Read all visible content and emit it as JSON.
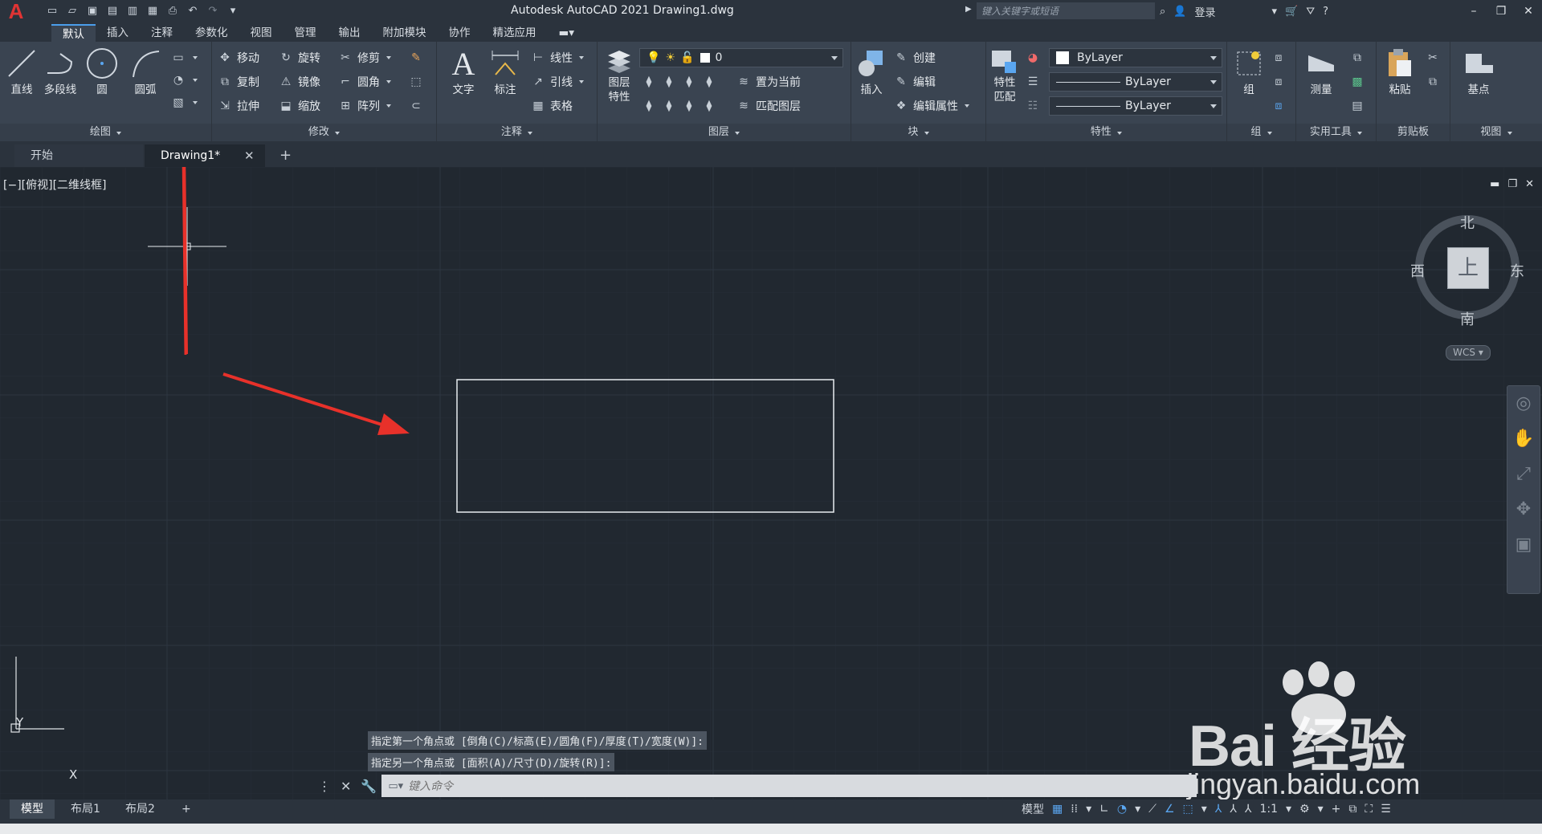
{
  "app": {
    "logo": "A",
    "title": "Autodesk AutoCAD 2021    Drawing1.dwg",
    "search_placeholder": "键入关键字或短语",
    "login": "登录"
  },
  "menu": [
    "默认",
    "插入",
    "注释",
    "参数化",
    "视图",
    "管理",
    "输出",
    "附加模块",
    "协作",
    "精选应用"
  ],
  "ribbon": {
    "draw": {
      "title": "绘图",
      "line": "直线",
      "polyline": "多段线",
      "circle": "圆",
      "arc": "圆弧"
    },
    "modify": {
      "title": "修改",
      "move": "移动",
      "rotate": "旋转",
      "trim": "修剪",
      "copy": "复制",
      "mirror": "镜像",
      "fillet": "圆角",
      "stretch": "拉伸",
      "scale": "缩放",
      "array": "阵列"
    },
    "annotation": {
      "title": "注释",
      "text": "文字",
      "dimension": "标注",
      "linear": "线性",
      "leader": "引线",
      "table": "表格"
    },
    "layers": {
      "title": "图层",
      "layer_properties": "图层\n特性",
      "layer_value": "0",
      "set_current": "置为当前",
      "match_layer": "匹配图层"
    },
    "block": {
      "title": "块",
      "insert": "插入",
      "create": "创建",
      "edit": "编辑",
      "edit_attributes": "编辑属性"
    },
    "properties": {
      "title": "特性",
      "match": "特性\n匹配",
      "color": "ByLayer",
      "linetype": "ByLayer",
      "lineweight": "ByLayer"
    },
    "groups": {
      "title": "组",
      "group": "组"
    },
    "utilities": {
      "title": "实用工具",
      "measure": "测量"
    },
    "clipboard": {
      "title": "剪贴板",
      "paste": "粘贴"
    },
    "view": {
      "title": "视图",
      "base": "基点"
    }
  },
  "file_tabs": {
    "start": "开始",
    "drawing": "Drawing1*"
  },
  "viewport": {
    "label": "[−][俯视][二维线框]"
  },
  "viewcube": {
    "north": "北",
    "south": "南",
    "east": "东",
    "west": "西",
    "top": "上",
    "wcs": "WCS"
  },
  "command": {
    "history": [
      "指定第一个角点或 [倒角(C)/标高(E)/圆角(F)/厚度(T)/宽度(W)]:",
      "指定另一个角点或 [面积(A)/尺寸(D)/旋转(R)]:"
    ],
    "placeholder": "键入命令"
  },
  "status": {
    "layouts": [
      "模型",
      "布局1",
      "布局2"
    ],
    "model": "模型",
    "scale": "1:1"
  },
  "ucs": {
    "x": "X",
    "y": "Y"
  },
  "watermark": {
    "logo": "Bai 经验",
    "url": "jingyan.baidu.com"
  },
  "colors": {
    "background": "#212830",
    "ribbon": "#3a4451",
    "arrow": "#e8312a",
    "accent": "#4a9dea"
  }
}
